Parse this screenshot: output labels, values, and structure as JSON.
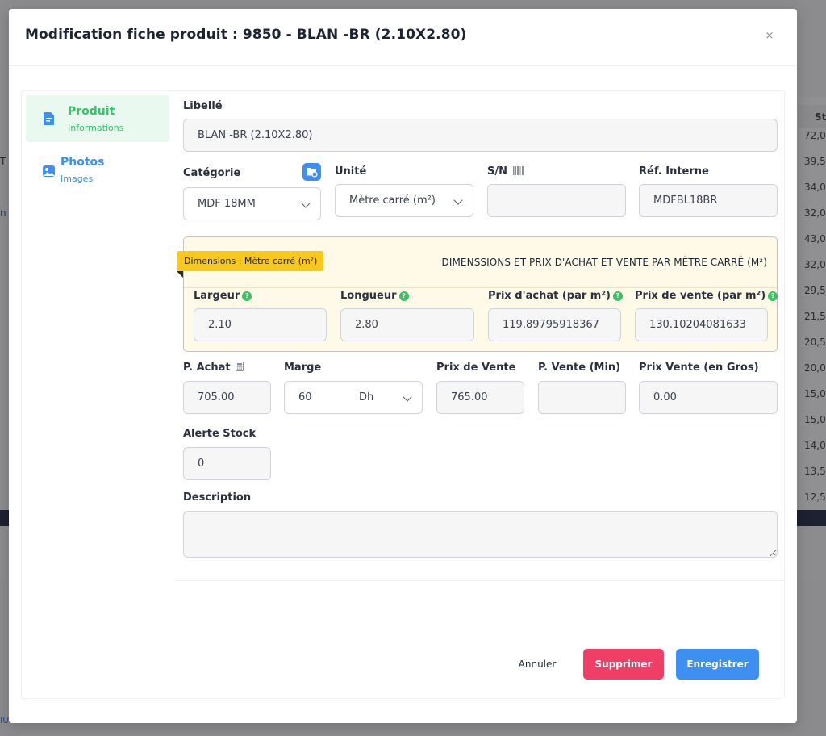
{
  "background": {
    "column_header": "Sto",
    "cells": [
      "72,0",
      "39,5",
      "34,0",
      "32,0",
      "43,0",
      "32,0",
      "29,5",
      "21,5",
      "20,5",
      "20,0",
      "15,0",
      "15,0",
      "14,0",
      "13,5",
      "12,5"
    ],
    "left_marks": [
      "T",
      "n"
    ],
    "footer_fragment": "IUM"
  },
  "modal": {
    "title": "Modification fiche produit : 9850 - BLAN -BR (2.10X2.80)",
    "close_glyph": "×"
  },
  "sidebar": {
    "items": [
      {
        "label": "Produit",
        "sub": "Informations",
        "icon": "document-icon",
        "active": true
      },
      {
        "label": "Photos",
        "sub": "Images",
        "icon": "image-icon",
        "active": false
      }
    ]
  },
  "form": {
    "libelle": {
      "label": "Libellé",
      "value": "BLAN -BR (2.10X2.80)"
    },
    "categorie": {
      "label": "Catégorie",
      "value": "MDF 18MM"
    },
    "unite": {
      "label": "Unité",
      "value": "Mètre carré (m²)"
    },
    "sn": {
      "label": "S/N",
      "value": ""
    },
    "ref_interne": {
      "label": "Réf. Interne",
      "value": "MDFBL18BR"
    },
    "dimensions": {
      "ribbon": "Dimensions : Mètre carré (m²)",
      "title": "DIMENSSIONS ET PRIX D'ACHAT ET VENTE PAR MÈTRE CARRÉ (M²)",
      "largeur": {
        "label": "Largeur",
        "value": "2.10"
      },
      "longueur": {
        "label": "Longueur",
        "value": "2.80"
      },
      "prix_achat": {
        "label": "Prix d'achat (par m²)",
        "value": "119.89795918367"
      },
      "prix_vente": {
        "label": "Prix de vente (par m²)",
        "value": "130.10204081633"
      }
    },
    "p_achat": {
      "label": "P. Achat",
      "value": "705.00"
    },
    "marge": {
      "label": "Marge",
      "value": "60",
      "unit": "Dh"
    },
    "prix_vente": {
      "label": "Prix de Vente",
      "value": "765.00"
    },
    "p_vente_min": {
      "label": "P. Vente (Min)",
      "value": ""
    },
    "prix_vente_gros": {
      "label": "Prix Vente (en Gros)",
      "value": "0.00"
    },
    "alerte_stock": {
      "label": "Alerte Stock",
      "value": "0"
    },
    "description": {
      "label": "Description",
      "value": ""
    }
  },
  "actions": {
    "cancel": "Annuler",
    "delete": "Supprimer",
    "save": "Enregistrer"
  },
  "colors": {
    "success": "#33c467",
    "primary": "#3d8ff2",
    "danger": "#f03e66",
    "warning": "#f8c81b"
  }
}
